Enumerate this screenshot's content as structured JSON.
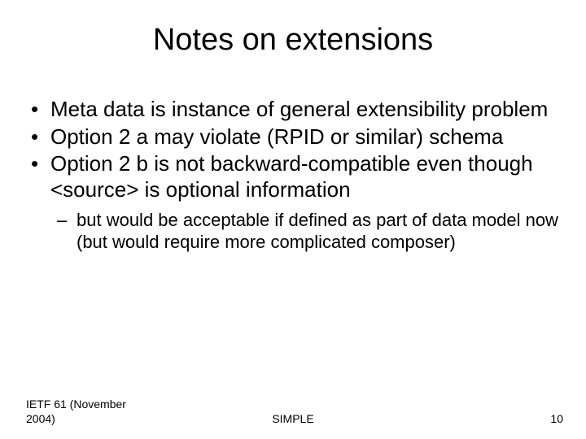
{
  "title": "Notes on extensions",
  "bullets": [
    {
      "text": "Meta data is instance of general extensibility problem"
    },
    {
      "text": "Option 2 a may violate (RPID or similar) schema"
    },
    {
      "text": "Option 2 b is not backward-compatible even though <source> is optional information",
      "sub": [
        {
          "text": "but would be acceptable if defined as part of data model now (but would require more complicated composer)"
        }
      ]
    }
  ],
  "footer": {
    "left": "IETF 61 (November 2004)",
    "center": "SIMPLE",
    "right": "10"
  }
}
